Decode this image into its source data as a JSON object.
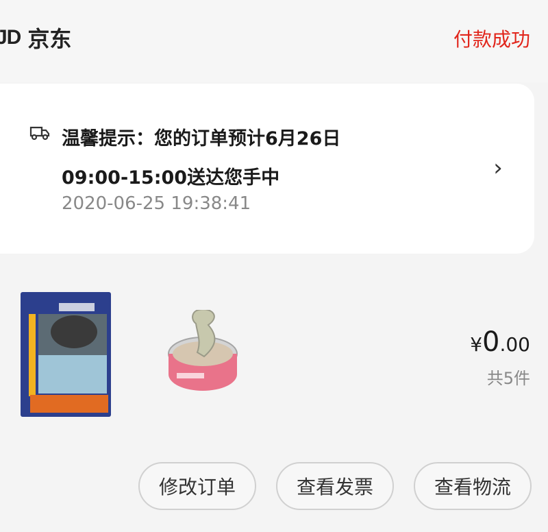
{
  "header": {
    "logo_text": "JD",
    "store_name": "京东",
    "status": "付款成功"
  },
  "notice": {
    "icon": "delivery-truck-icon",
    "line1": "温馨提示：您的订单预计6月26日",
    "line2": "09:00-15:00送达您手中",
    "timestamp": "2020-06-25 19:38:41",
    "arrow": "›"
  },
  "order": {
    "products": [
      {
        "name": "product-cat-food-pouch",
        "icon": "cat-food-pouch"
      },
      {
        "name": "product-cat-food-can",
        "icon": "cat-food-can"
      }
    ],
    "price_symbol": "¥",
    "price_integer": "0",
    "price_decimal": ".00",
    "count": "共5件"
  },
  "actions": {
    "modify": "修改订单",
    "invoice": "查看发票",
    "logistics": "查看物流"
  },
  "colors": {
    "accent": "#e1251b"
  }
}
